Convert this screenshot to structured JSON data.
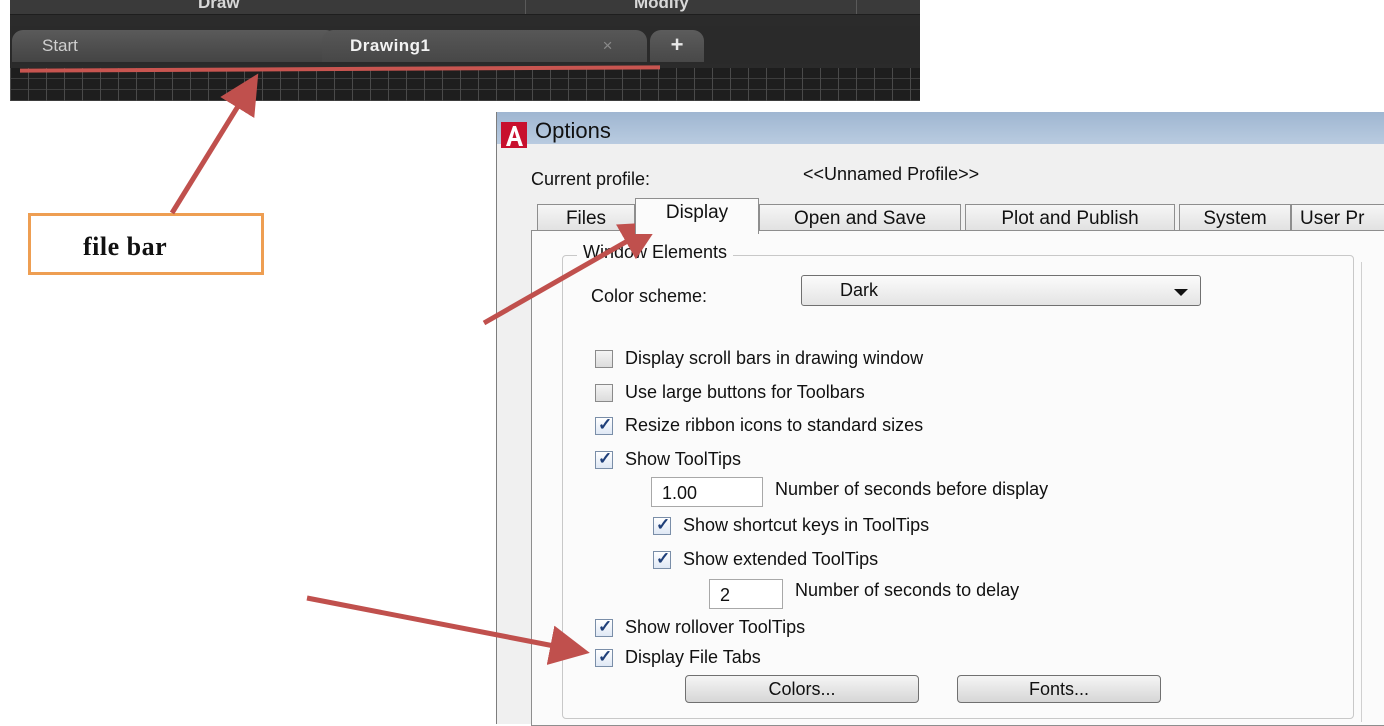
{
  "autocad": {
    "ribbon_panels": [
      "Draw",
      "Modify"
    ],
    "file_tabs": [
      {
        "label": "Start"
      },
      {
        "label": "Drawing1",
        "close": "×"
      },
      {
        "label": "+"
      }
    ]
  },
  "annotation": {
    "label": "file bar"
  },
  "dialog": {
    "title": "Options",
    "current_profile_label": "Current profile:",
    "current_profile_value": "<<Unnamed Profile>>",
    "tabs": [
      "Files",
      "Display",
      "Open and Save",
      "Plot and Publish",
      "System",
      "User Pr"
    ],
    "active_tab": "Display",
    "group_title": "Window Elements",
    "color_scheme_label": "Color scheme:",
    "color_scheme_value": "Dark",
    "options": {
      "scroll_bars": {
        "label": "Display scroll bars in drawing window",
        "checked": false
      },
      "large_buttons": {
        "label": "Use large buttons for Toolbars",
        "checked": false
      },
      "resize_ribbon": {
        "label": "Resize ribbon icons to standard sizes",
        "checked": true
      },
      "show_tooltips": {
        "label": "Show ToolTips",
        "checked": true
      },
      "tooltip_delay_value": "1.00",
      "tooltip_delay_label": "Number of seconds before display",
      "shortcut_keys": {
        "label": "Show shortcut keys in ToolTips",
        "checked": true
      },
      "extended_tooltips": {
        "label": "Show extended ToolTips",
        "checked": true
      },
      "extended_delay_value": "2",
      "extended_delay_label": "Number of seconds to delay",
      "rollover_tooltips": {
        "label": "Show rollover ToolTips",
        "checked": true
      },
      "file_tabs": {
        "label": "Display File Tabs",
        "checked": true
      }
    },
    "buttons": {
      "colors": "Colors...",
      "fonts": "Fonts..."
    }
  },
  "colors": {
    "arrow": "#c0504d",
    "callout_border": "#f79646",
    "acad_bg": "#2b2b2b"
  }
}
